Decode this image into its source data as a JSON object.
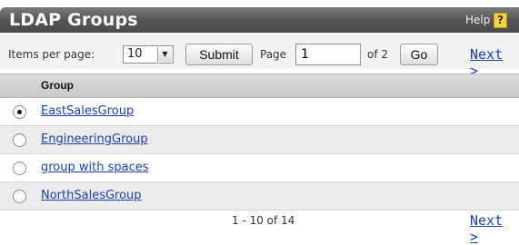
{
  "panel": {
    "title": "LDAP Groups",
    "help_label": "Help",
    "help_icon": "?"
  },
  "toolbar": {
    "items_per_page_label": "Items per page:",
    "items_per_page_value": "10",
    "submit_label": "Submit",
    "page_label": "Page",
    "page_value": "1",
    "of_label": "of 2",
    "go_label": "Go",
    "next_label": "Next >"
  },
  "table": {
    "column_header": "Group",
    "rows": [
      {
        "name": "EastSalesGroup",
        "selected": true
      },
      {
        "name": "EngineeringGroup",
        "selected": false
      },
      {
        "name": "group with spaces",
        "selected": false
      },
      {
        "name": "NorthSalesGroup",
        "selected": false
      }
    ]
  },
  "footer": {
    "range_text": "1 - 10 of 14",
    "next_label": "Next >"
  },
  "colors": {
    "titlebar": "#565656",
    "link": "#1a3fbd",
    "row_alt": "#ececec",
    "header": "#d2d2d2"
  }
}
